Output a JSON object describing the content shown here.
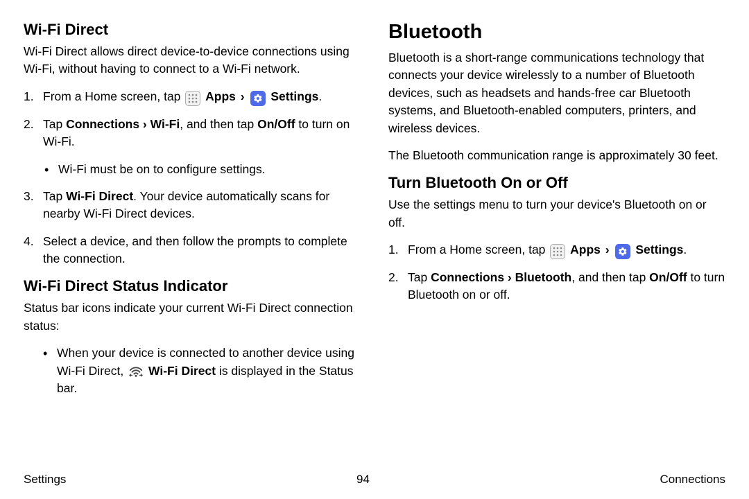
{
  "left": {
    "h_wifidirect": "Wi-Fi Direct",
    "wifidirect_desc": "Wi-Fi Direct allows direct device-to-device connections using Wi-Fi, without having to connect to a Wi-Fi network.",
    "step1_a": "From a Home screen, tap ",
    "apps_label": "Apps",
    "chev": "›",
    "settings_label": "Settings",
    "period": ".",
    "step2_a": "Tap ",
    "step2_b": "Connections › Wi-Fi",
    "step2_c": ", and then tap ",
    "step2_d": "On/Off",
    "step2_e": " to turn on Wi-Fi.",
    "step2_sub": "Wi-Fi must be on to configure settings.",
    "step3_a": "Tap ",
    "step3_b": "Wi-Fi Direct",
    "step3_c": ". Your device automatically scans for nearby Wi-Fi Direct devices.",
    "step4": "Select a device, and then follow the prompts to complete the connection.",
    "h_status": "Wi-Fi Direct Status Indicator",
    "status_desc": "Status bar icons indicate your current Wi-Fi Direct connection status:",
    "bullet_a": "When your device is connected to another device using Wi-Fi Direct, ",
    "bullet_b": "Wi-Fi Direct",
    "bullet_c": " is displayed in the Status bar."
  },
  "right": {
    "h_bluetooth": "Bluetooth",
    "bt_desc": "Bluetooth is a short-range communications technology that connects your device wirelessly to a number of Bluetooth devices, such as headsets and hands-free car Bluetooth systems, and Bluetooth-enabled computers, printers, and wireless devices.",
    "bt_range": "The Bluetooth communication range is approximately 30 feet.",
    "h_turn": "Turn Bluetooth On or Off",
    "turn_desc": "Use the settings menu to turn your device's Bluetooth on or off.",
    "rstep1_a": "From a Home screen, tap ",
    "rstep2_a": "Tap ",
    "rstep2_b": "Connections › Bluetooth",
    "rstep2_c": ", and then tap ",
    "rstep2_d": "On/Off",
    "rstep2_e": " to turn Bluetooth on or off."
  },
  "footer": {
    "left": "Settings",
    "center": "94",
    "right": "Connections"
  }
}
